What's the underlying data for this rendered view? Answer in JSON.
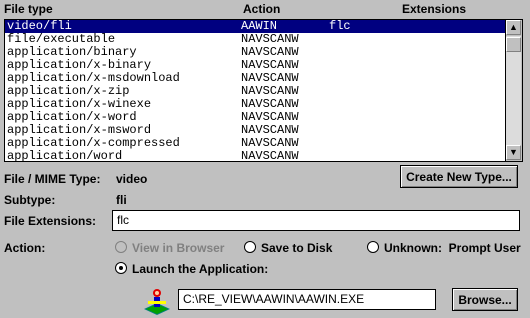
{
  "columns": {
    "file_type": "File type",
    "action": "Action",
    "extensions": "Extensions"
  },
  "rows": [
    {
      "type": "video/fli",
      "action": "AAWIN",
      "ext": "flc",
      "selected": true
    },
    {
      "type": "file/executable",
      "action": "NAVSCANW",
      "ext": ""
    },
    {
      "type": "application/binary",
      "action": "NAVSCANW",
      "ext": ""
    },
    {
      "type": "application/x-binary",
      "action": "NAVSCANW",
      "ext": ""
    },
    {
      "type": "application/x-msdownload",
      "action": "NAVSCANW",
      "ext": ""
    },
    {
      "type": "application/x-zip",
      "action": "NAVSCANW",
      "ext": ""
    },
    {
      "type": "application/x-winexe",
      "action": "NAVSCANW",
      "ext": ""
    },
    {
      "type": "application/x-word",
      "action": "NAVSCANW",
      "ext": ""
    },
    {
      "type": "application/x-msword",
      "action": "NAVSCANW",
      "ext": ""
    },
    {
      "type": "application/x-compressed",
      "action": "NAVSCANW",
      "ext": ""
    },
    {
      "type": "application/word",
      "action": "NAVSCANW",
      "ext": ""
    }
  ],
  "details": {
    "mime_label": "File / MIME Type:",
    "mime_value": "video",
    "subtype_label": "Subtype:",
    "subtype_value": "fli",
    "ext_label": "File Extensions:",
    "ext_value": "flc",
    "action_label": "Action:"
  },
  "buttons": {
    "create_new_type": "Create New Type...",
    "browse": "Browse..."
  },
  "radios": {
    "view_in_browser": "View in Browser",
    "save_to_disk": "Save to Disk",
    "unknown_prompt": "Unknown:  Prompt User",
    "launch_app": "Launch the Application:",
    "selected": "launch_app"
  },
  "app_path": "C:\\RE_VIEW\\AAWIN\\AAWIN.EXE",
  "scrollbar": {
    "up": "▲",
    "down": "▼"
  },
  "icons": {
    "app": "aawin-app-icon"
  }
}
